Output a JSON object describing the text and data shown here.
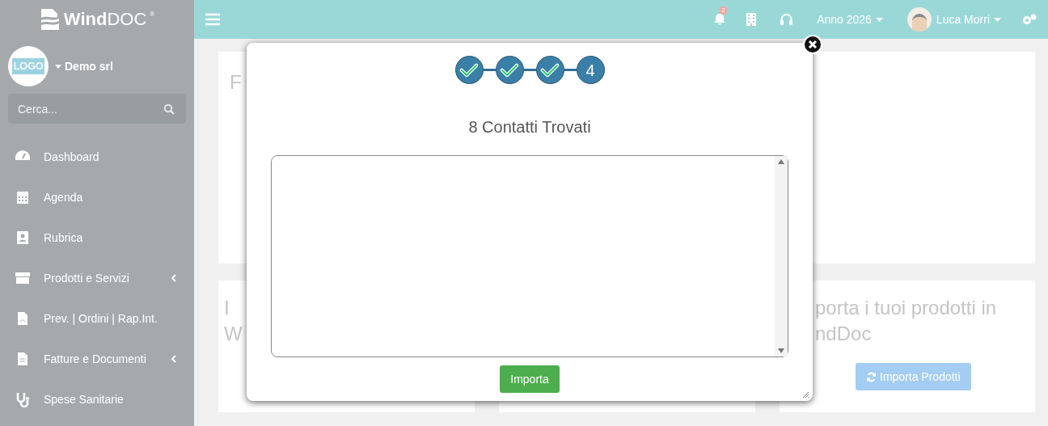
{
  "sidebar": {
    "brand": {
      "bold": "Wind",
      "light": "DOC",
      "mark": "®"
    },
    "company": {
      "logo": "LOGO",
      "name": "Demo srl"
    },
    "search": {
      "placeholder": "Cerca..."
    },
    "items": [
      {
        "label": "Dashboard",
        "expandable": false
      },
      {
        "label": "Agenda",
        "expandable": false
      },
      {
        "label": "Rubrica",
        "expandable": false
      },
      {
        "label": "Prodotti e Servizi",
        "expandable": true
      },
      {
        "label": "Prev. | Ordini | Rap.Int.",
        "expandable": false
      },
      {
        "label": "Fatture e Documenti",
        "expandable": true
      },
      {
        "label": "Spese Sanitarie",
        "expandable": false
      }
    ]
  },
  "topbar": {
    "notifications": "2",
    "year": "Anno 2026",
    "user": "Luca Morri"
  },
  "background": {
    "top_card": {
      "title": "F"
    },
    "cards": [
      {
        "lines": [
          "I",
          "W"
        ]
      },
      {
        "lines": [
          "porta i tuoi prodotti in",
          "ndDoc"
        ],
        "button": "Importa Prodotti"
      }
    ]
  },
  "dialog": {
    "steps": [
      {
        "done": true
      },
      {
        "done": true
      },
      {
        "done": true
      },
      {
        "done": false,
        "label": "4"
      }
    ],
    "title": "8 Contatti Trovati",
    "button": "Importa"
  }
}
